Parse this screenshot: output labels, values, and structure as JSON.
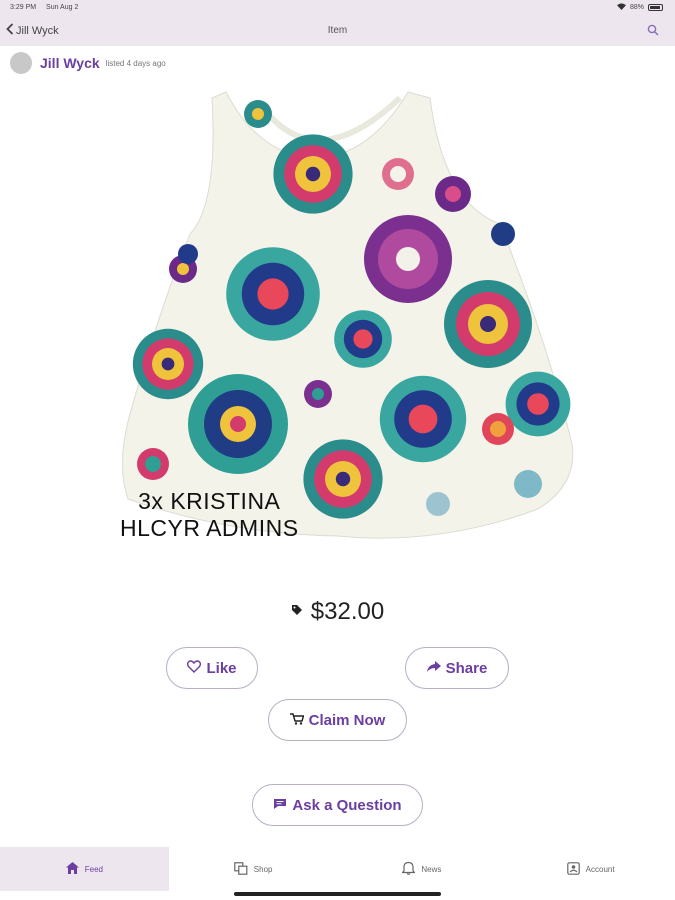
{
  "status_bar": {
    "time": "3:29 PM",
    "date": "Sun Aug 2",
    "battery": "88%"
  },
  "nav": {
    "back_label": "Jill Wyck",
    "title": "Item"
  },
  "seller": {
    "name": "Jill Wyck",
    "listed": "listed 4 days ago"
  },
  "item": {
    "caption_line1": "3x KRISTINA",
    "caption_line2": "HLCYR ADMINS",
    "price": "$32.00"
  },
  "actions": {
    "like": "Like",
    "share": "Share",
    "claim": "Claim Now",
    "ask": "Ask a Question"
  },
  "tabs": [
    {
      "label": "Feed",
      "icon": "home-icon",
      "active": true
    },
    {
      "label": "Shop",
      "icon": "shop-icon",
      "active": false
    },
    {
      "label": "News",
      "icon": "bell-icon",
      "active": false
    },
    {
      "label": "Account",
      "icon": "account-icon",
      "active": false
    }
  ],
  "colors": {
    "accent": "#6a3fa0",
    "header_bg": "#ede6ef",
    "pill_border": "#b9aec4"
  }
}
